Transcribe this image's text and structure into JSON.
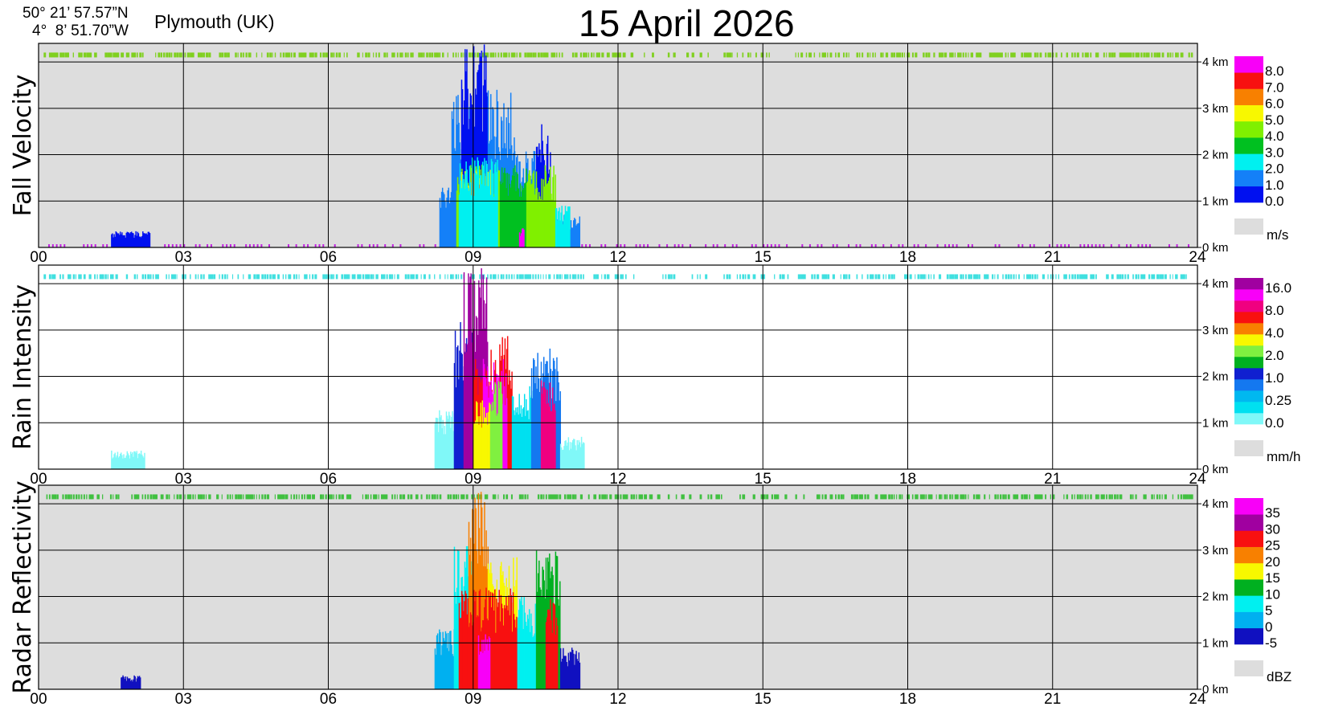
{
  "header": {
    "latitude": "50° 21’ 57.57”N",
    "longitude": "4°  8’ 51.70”W",
    "location": "Plymouth (UK)",
    "date": "15 April 2026"
  },
  "colors": {
    "background": "#ffffff",
    "no_data": "#dddddd",
    "grid": "#000000"
  },
  "chart_data": [
    {
      "type": "heatmap",
      "ylabel": "Fall Velocity",
      "x_ticks": [
        "00",
        "03",
        "06",
        "09",
        "12",
        "15",
        "18",
        "21",
        "24"
      ],
      "xlim": [
        0,
        24
      ],
      "alt_ticks": [
        "0 km",
        "1 km",
        "2 km",
        "3 km",
        "4 km"
      ],
      "ylim": [
        0,
        4.4
      ],
      "background": "#dddddd",
      "unit": "m/s",
      "legend": [
        {
          "label": "0.0",
          "color": "#0010f0"
        },
        {
          "label": "1.0",
          "color": "#1480f8"
        },
        {
          "label": "2.0",
          "color": "#00f0f0"
        },
        {
          "label": "3.0",
          "color": "#00c020"
        },
        {
          "label": "4.0",
          "color": "#80f000"
        },
        {
          "label": "5.0",
          "color": "#f8f800"
        },
        {
          "label": "6.0",
          "color": "#f88000"
        },
        {
          "label": "7.0",
          "color": "#f81010"
        },
        {
          "label": "8.0",
          "color": "#f800f8"
        }
      ],
      "echo_band": {
        "altitude": 4.15,
        "color": "#80d020"
      },
      "events": [
        {
          "start": 8.3,
          "end": 8.65,
          "top": 1.3,
          "color": "#1480f8"
        },
        {
          "start": 8.55,
          "end": 8.95,
          "top": 3.3,
          "color": "#1480f8"
        },
        {
          "start": 8.75,
          "end": 9.3,
          "top": 4.4,
          "color": "#0010f0"
        },
        {
          "start": 9.3,
          "end": 9.85,
          "top": 3.4,
          "color": "#1480f8"
        },
        {
          "start": 9.85,
          "end": 10.3,
          "top": 2.1,
          "color": "#1480f8"
        },
        {
          "start": 10.3,
          "end": 10.6,
          "top": 2.8,
          "color": "#0010f0"
        },
        {
          "start": 10.6,
          "end": 11.2,
          "top": 0.7,
          "color": "#1480f8"
        },
        {
          "start": 8.65,
          "end": 9.55,
          "top": 1.8,
          "color": "#80f000"
        },
        {
          "start": 8.75,
          "end": 9.35,
          "top": 1.7,
          "color": "#f8f800"
        },
        {
          "start": 8.85,
          "end": 9.25,
          "top": 1.65,
          "color": "#f88000"
        },
        {
          "start": 9.55,
          "end": 10.1,
          "top": 1.85,
          "color": "#00c020"
        },
        {
          "start": 10.1,
          "end": 10.7,
          "top": 1.8,
          "color": "#80f000"
        },
        {
          "start": 10.7,
          "end": 11.0,
          "top": 0.9,
          "color": "#00f0f0"
        },
        {
          "start": 8.7,
          "end": 9.5,
          "top": 1.95,
          "color": "#00f0f0"
        },
        {
          "start": 9.95,
          "end": 10.05,
          "top": 0.45,
          "color": "#f800f8"
        },
        {
          "start": 1.5,
          "end": 2.3,
          "top": 0.35,
          "color": "#0010f0"
        }
      ]
    },
    {
      "type": "heatmap",
      "ylabel": "Rain Intensity",
      "x_ticks": [
        "00",
        "03",
        "06",
        "09",
        "12",
        "15",
        "18",
        "21",
        "24"
      ],
      "xlim": [
        0,
        24
      ],
      "alt_ticks": [
        "0 km",
        "1 km",
        "2 km",
        "3 km",
        "4 km"
      ],
      "ylim": [
        0,
        4.4
      ],
      "background": "#ffffff",
      "unit": "mm/h",
      "legend": [
        {
          "label": "0.0",
          "color": "#80f8f8"
        },
        {
          "label": null,
          "color": "#00e0f0"
        },
        {
          "label": "0.25",
          "color": "#00b8f0"
        },
        {
          "label": null,
          "color": "#1478f0"
        },
        {
          "label": "1.0",
          "color": "#1020d0"
        },
        {
          "label": null,
          "color": "#00b020"
        },
        {
          "label": "2.0",
          "color": "#80f040"
        },
        {
          "label": null,
          "color": "#f8f800"
        },
        {
          "label": "4.0",
          "color": "#f88000"
        },
        {
          "label": null,
          "color": "#f81010"
        },
        {
          "label": "8.0",
          "color": "#f00080"
        },
        {
          "label": null,
          "color": "#f800f8"
        },
        {
          "label": "16.0",
          "color": "#a000a0"
        }
      ],
      "echo_band": {
        "altitude": 4.15,
        "color": "#40e0e0"
      },
      "events": [
        {
          "start": 8.2,
          "end": 8.6,
          "top": 1.3,
          "color": "#80f8f8"
        },
        {
          "start": 8.6,
          "end": 9.0,
          "top": 3.2,
          "color": "#1020d0"
        },
        {
          "start": 8.8,
          "end": 9.3,
          "top": 4.4,
          "color": "#a000a0"
        },
        {
          "start": 9.0,
          "end": 9.8,
          "top": 2.9,
          "color": "#f81010"
        },
        {
          "start": 9.2,
          "end": 9.7,
          "top": 2.4,
          "color": "#f800f8"
        },
        {
          "start": 9.8,
          "end": 10.4,
          "top": 1.8,
          "color": "#00e0f0"
        },
        {
          "start": 10.2,
          "end": 10.8,
          "top": 2.6,
          "color": "#1478f0"
        },
        {
          "start": 10.4,
          "end": 10.7,
          "top": 2.0,
          "color": "#f00080"
        },
        {
          "start": 10.8,
          "end": 11.3,
          "top": 0.7,
          "color": "#80f8f8"
        },
        {
          "start": 9.0,
          "end": 9.35,
          "top": 1.6,
          "color": "#f8f800"
        },
        {
          "start": 9.35,
          "end": 9.6,
          "top": 1.9,
          "color": "#80f040"
        },
        {
          "start": 1.5,
          "end": 2.2,
          "top": 0.4,
          "color": "#80f8f8"
        }
      ]
    },
    {
      "type": "heatmap",
      "ylabel": "Radar Reflectivity",
      "x_ticks": [
        "00",
        "03",
        "06",
        "09",
        "12",
        "15",
        "18",
        "21",
        "24"
      ],
      "xlim": [
        0,
        24
      ],
      "alt_ticks": [
        "0 km",
        "1 km",
        "2 km",
        "3 km",
        "4 km"
      ],
      "ylim": [
        0,
        4.4
      ],
      "background": "#dddddd",
      "unit": "dBZ",
      "legend": [
        {
          "label": "-5",
          "color": "#1010c0"
        },
        {
          "label": "0",
          "color": "#00b0f0"
        },
        {
          "label": "5",
          "color": "#00f0f0"
        },
        {
          "label": "10",
          "color": "#00b020"
        },
        {
          "label": "15",
          "color": "#f8f800"
        },
        {
          "label": "20",
          "color": "#f88000"
        },
        {
          "label": "25",
          "color": "#f81010"
        },
        {
          "label": "30",
          "color": "#a000a0"
        },
        {
          "label": "35",
          "color": "#f800f8"
        }
      ],
      "echo_band": {
        "altitude": 4.15,
        "color": "#40c040"
      },
      "events": [
        {
          "start": 8.2,
          "end": 8.6,
          "top": 1.3,
          "color": "#00b0f0"
        },
        {
          "start": 8.6,
          "end": 9.0,
          "top": 3.1,
          "color": "#00f0f0"
        },
        {
          "start": 8.9,
          "end": 9.3,
          "top": 4.4,
          "color": "#f88000"
        },
        {
          "start": 9.3,
          "end": 9.9,
          "top": 2.9,
          "color": "#f8f800"
        },
        {
          "start": 9.9,
          "end": 10.4,
          "top": 2.0,
          "color": "#00f0f0"
        },
        {
          "start": 10.3,
          "end": 10.8,
          "top": 3.0,
          "color": "#00b020"
        },
        {
          "start": 10.8,
          "end": 11.2,
          "top": 0.9,
          "color": "#1010c0"
        },
        {
          "start": 8.7,
          "end": 9.9,
          "top": 2.2,
          "color": "#f81010"
        },
        {
          "start": 10.5,
          "end": 10.75,
          "top": 2.0,
          "color": "#f81010"
        },
        {
          "start": 9.1,
          "end": 9.35,
          "top": 1.2,
          "color": "#f800f8"
        },
        {
          "start": 1.7,
          "end": 2.1,
          "top": 0.3,
          "color": "#1010c0"
        }
      ]
    }
  ]
}
